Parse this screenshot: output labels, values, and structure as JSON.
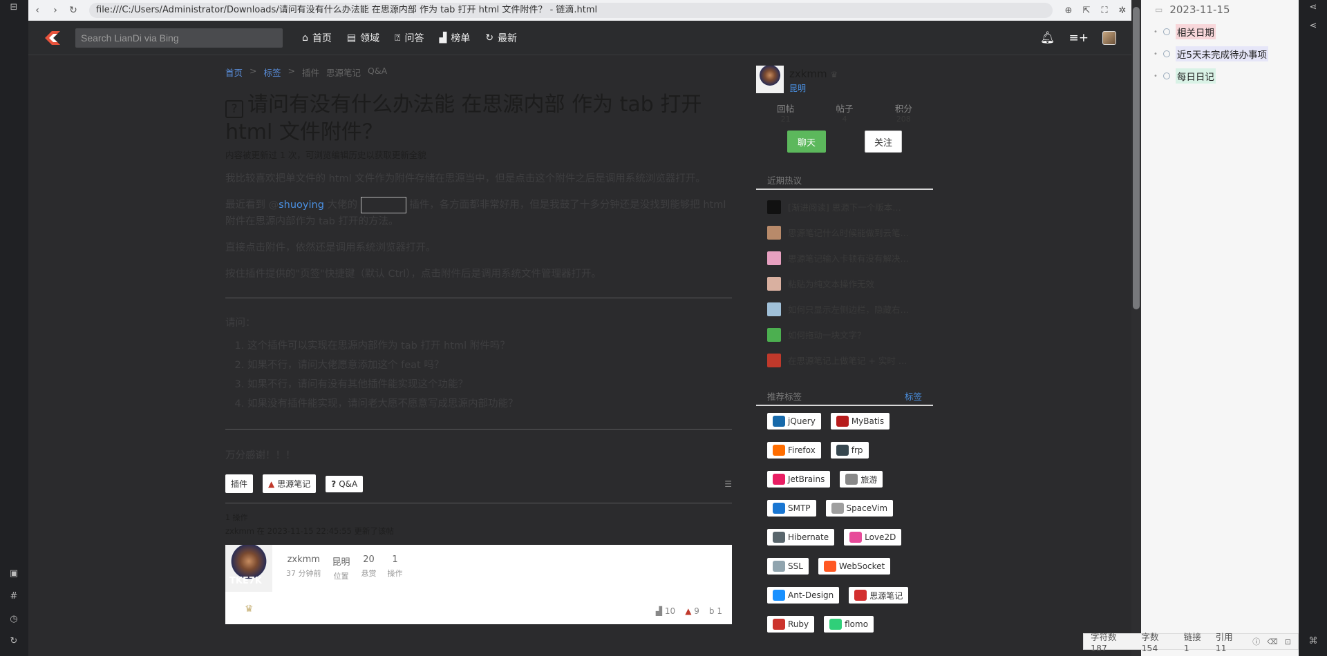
{
  "browser": {
    "url": "file:///C:/Users/Administrator/Downloads/请问有没有什么办法能 在思源内部 作为 tab 打开 html 文件附件？ - 链滴.html"
  },
  "header": {
    "search_placeholder": "Search LianDi via Bing",
    "nav": [
      {
        "label": "首页",
        "icon": "home-icon"
      },
      {
        "label": "领域",
        "icon": "domain-icon"
      },
      {
        "label": "问答",
        "icon": "qa-icon"
      },
      {
        "label": "榜单",
        "icon": "chart-icon"
      },
      {
        "label": "最新",
        "icon": "refresh-icon"
      }
    ]
  },
  "article": {
    "breadcrumb": [
      "首页",
      "标签",
      "插件",
      "思源笔记",
      "Q&A"
    ],
    "breadcrumb_sep": ">",
    "title": "请问有没有什么办法能 在思源内部 作为 tab 打开 html 文件附件？",
    "edit_note": "内容被更新过 1 次，可浏览编辑历史以获取更新全貌",
    "para1": "我比较喜欢把单文件的 html 文件作为附件存储在思源当中，但是点击这个附件之后是调用系统浏览器打开。",
    "para2_pre": "最近看到 @",
    "para2_mention": "shuoying",
    "para2_mid": " 大佬的 ",
    "para2_post": " 插件，各方面都非常好用，但是我鼓了十多分钟还是没找到能够把 html 附件在思源内部作为 tab 打开的方法。",
    "para3": "直接点击附件，依然还是调用系统浏览器打开。",
    "para4": "按住插件提供的\"页签\"快捷键（默认 Ctrl），点击附件后是调用系统文件管理器打开。",
    "ask_label": "请问：",
    "questions": [
      "这个插件可以实现在思源内部作为 tab 打开 html 附件吗？",
      "如果不行，请问大佬愿意添加这个 feat 吗？",
      "如果不行，请问有没有其他插件能实现这个功能？",
      "如果没有插件能实现，请问老大愿不愿意写成思源内部功能？"
    ],
    "thanks": "万分感谢！！！",
    "tags": [
      {
        "label": "插件",
        "icon": ""
      },
      {
        "label": "思源笔记",
        "icon": "siyuan-icon"
      },
      {
        "label": "Q&A",
        "icon": "question-icon"
      }
    ],
    "op_count": "1 操作",
    "op_log": "zxkmm 在 2023-11-15 22:45:55 更新了该帖"
  },
  "comment": {
    "avatar_text": "TKE7K",
    "stats": [
      {
        "value": "zxkmm",
        "label": "37 分钟前"
      },
      {
        "value": "昆明",
        "label": "位置"
      },
      {
        "value": "20",
        "label": "悬赏"
      },
      {
        "value": "1",
        "label": "操作"
      }
    ],
    "meta": {
      "views": "10",
      "siyuan": "9",
      "bing": "1"
    }
  },
  "author": {
    "name": "zxkmm",
    "location": "昆明",
    "stats": [
      {
        "label": "回帖",
        "value": "21"
      },
      {
        "label": "帖子",
        "value": "4"
      },
      {
        "label": "积分",
        "value": "208"
      }
    ],
    "chat_label": "聊天",
    "follow_label": "关注"
  },
  "hot": {
    "title": "近期热议",
    "items": [
      {
        "text": "[渐进阅读] 思源下一个版本…",
        "color": "#111111"
      },
      {
        "text": "思源笔记什么时候能做到云笔…",
        "color": "#b88a6a"
      },
      {
        "text": "思源笔记输入卡顿有没有解决…",
        "color": "#e7a0c0"
      },
      {
        "text": "粘贴为纯文本操作无效",
        "color": "#d9b0a0"
      },
      {
        "text": "如何只显示左侧边栏，隐藏右…",
        "color": "#a0c0d8"
      },
      {
        "text": "如何拖动一块文字？",
        "color": "#4caf50"
      },
      {
        "text": "在思源笔记上做笔记 + 实时 …",
        "color": "#c0392b"
      }
    ]
  },
  "recommend": {
    "title": "推荐标签",
    "link": "标签",
    "tags": [
      {
        "label": "jQuery",
        "color": "#1769aa"
      },
      {
        "label": "MyBatis",
        "color": "#b71c1c"
      },
      {
        "label": "Firefox",
        "color": "#ff6d00"
      },
      {
        "label": "frp",
        "color": "#37474f"
      },
      {
        "label": "JetBrains",
        "color": "#e91e63"
      },
      {
        "label": "旅游",
        "color": "#888888"
      },
      {
        "label": "SMTP",
        "color": "#1976d2"
      },
      {
        "label": "SpaceVim",
        "color": "#9e9e9e"
      },
      {
        "label": "Hibernate",
        "color": "#59666c"
      },
      {
        "label": "Love2D",
        "color": "#e74a99"
      },
      {
        "label": "SSL",
        "color": "#90a4ae"
      },
      {
        "label": "WebSocket",
        "color": "#ff5722"
      },
      {
        "label": "Ant-Design",
        "color": "#1890ff"
      },
      {
        "label": "思源笔记",
        "color": "#d32f2f"
      },
      {
        "label": "Ruby",
        "color": "#cc342d"
      },
      {
        "label": "flomo",
        "color": "#30cf79"
      }
    ]
  },
  "siyuan": {
    "doc_title": "2023-11-15",
    "items": [
      {
        "label": "相关日期",
        "highlight": "#f8d7da"
      },
      {
        "label": "近5天未完成待办事项",
        "highlight": "#e6e6f8"
      },
      {
        "label": "每日日记",
        "highlight": "#d9f2e6"
      }
    ],
    "status": {
      "chars": "字符数 187",
      "words": "字数 154",
      "links": "链接 1",
      "refs": "引用 11"
    }
  }
}
